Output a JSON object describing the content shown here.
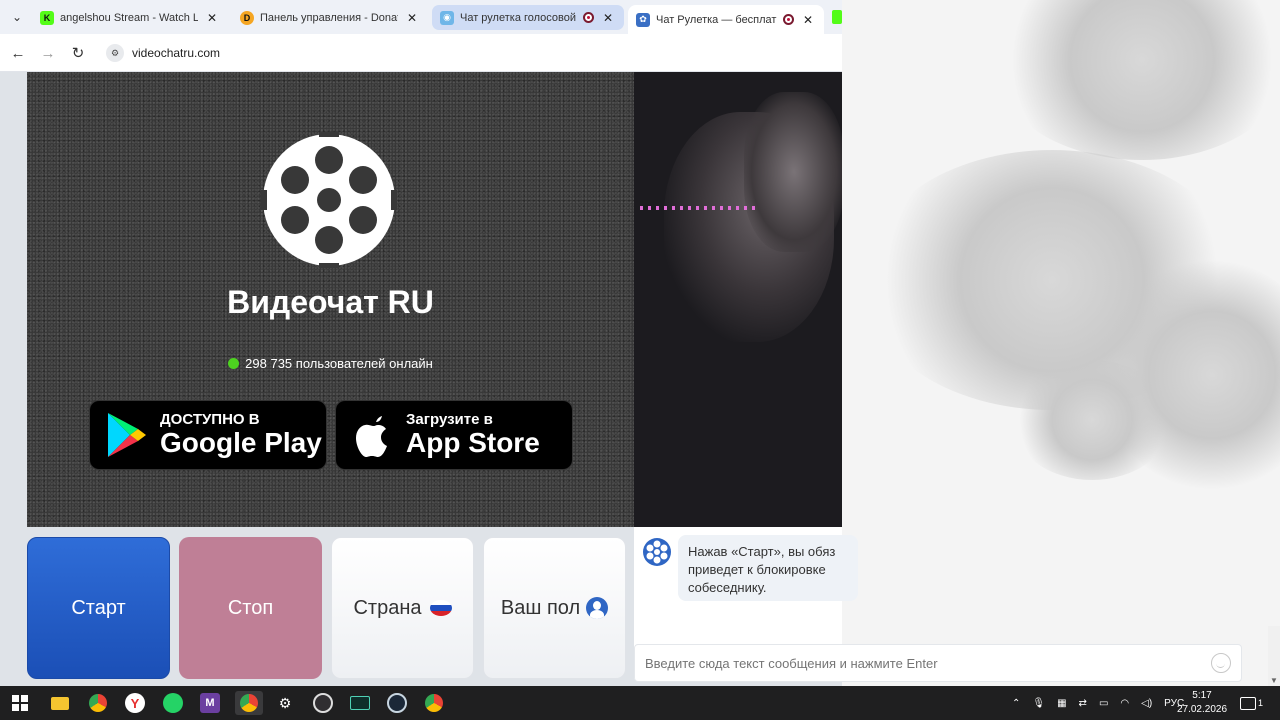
{
  "browser": {
    "tabs": [
      {
        "title": "angelshou Stream - Watch Live",
        "favicon": "K",
        "favicon_color": "#53fc18",
        "recording": false
      },
      {
        "title": "Панель управления - Donation",
        "favicon": "D",
        "favicon_color": "#f5a623",
        "recording": false
      },
      {
        "title": "Чат рулетка голосовой —",
        "favicon": "◉",
        "favicon_color": "#6fb6e8",
        "recording": true
      },
      {
        "title": "Чат Рулетка — бесплатный",
        "favicon": "✿",
        "favicon_color": "#3a6fc4",
        "recording": true
      }
    ],
    "address": "videochatru.com"
  },
  "stage": {
    "brand": "Видеочат RU",
    "online_text": "298 735 пользователей онлайн",
    "google_play": {
      "small": "ДОСТУПНО В",
      "big": "Google Play"
    },
    "app_store": {
      "small": "Загрузите в",
      "big": "App Store"
    }
  },
  "controls": {
    "start": "Старт",
    "stop": "Стоп",
    "country": "Страна",
    "sex": "Ваш пол"
  },
  "chat": {
    "message_lines": [
      "Нажав «Старт», вы обяз",
      "приведет к блокировке",
      "собеседнику."
    ],
    "input_placeholder": "Введите сюда текст сообщения и нажмите Enter"
  },
  "taskbar": {
    "lang": "РУС",
    "time": "5:17",
    "date": "27.02.2026",
    "notifications": "1"
  },
  "colors": {
    "start": "#1f5cc6",
    "stop": "#bf7f96",
    "online_dot": "#4dd220"
  }
}
